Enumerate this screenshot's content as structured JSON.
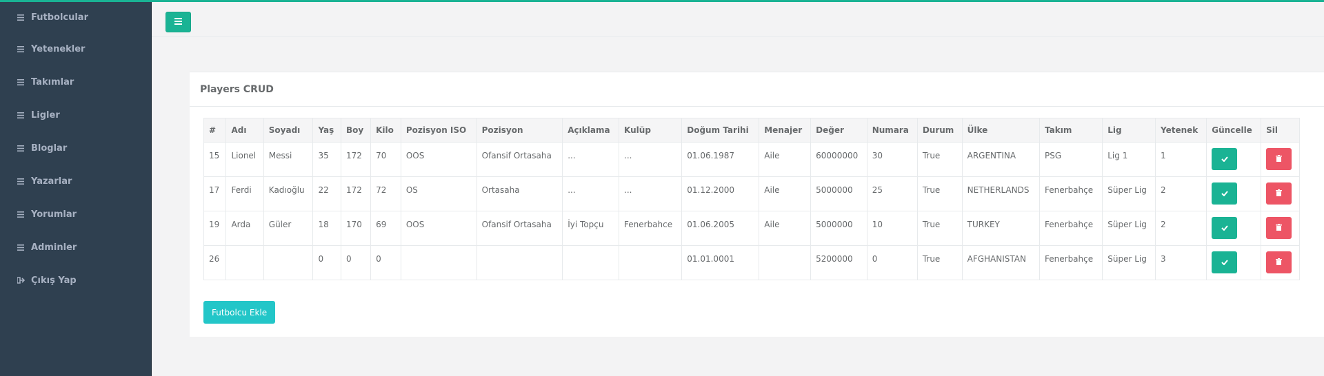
{
  "sidebar": {
    "items": [
      {
        "label": "Futbolcular",
        "icon": "menu-icon"
      },
      {
        "label": "Yetenekler",
        "icon": "menu-icon"
      },
      {
        "label": "Takımlar",
        "icon": "menu-icon"
      },
      {
        "label": "Ligler",
        "icon": "menu-icon"
      },
      {
        "label": "Bloglar",
        "icon": "menu-icon"
      },
      {
        "label": "Yazarlar",
        "icon": "menu-icon"
      },
      {
        "label": "Yorumlar",
        "icon": "menu-icon"
      },
      {
        "label": "Adminler",
        "icon": "menu-icon"
      },
      {
        "label": "Çıkış Yap",
        "icon": "sign-out-icon"
      }
    ]
  },
  "colors": {
    "accent": "#1ab394",
    "sidebar": "#2f4050",
    "danger": "#ed5565",
    "info": "#23c6c8"
  },
  "card": {
    "title": "Players CRUD"
  },
  "table": {
    "headers": [
      "#",
      "Adı",
      "Soyadı",
      "Yaş",
      "Boy",
      "Kilo",
      "Pozisyon ISO",
      "Pozisyon",
      "Açıklama",
      "Kulüp",
      "Doğum Tarihi",
      "Menajer",
      "Değer",
      "Numara",
      "Durum",
      "Ülke",
      "Takım",
      "Lig",
      "Yetenek",
      "Güncelle",
      "Sil"
    ],
    "rows": [
      [
        "15",
        "Lionel",
        "Messi",
        "35",
        "172",
        "70",
        "OOS",
        "Ofansif Ortasaha",
        "...",
        "...",
        "01.06.1987",
        "Aile",
        "60000000",
        "30",
        "True",
        "ARGENTINA",
        "PSG",
        "Lig 1",
        "1"
      ],
      [
        "17",
        "Ferdi",
        "Kadıoğlu",
        "22",
        "172",
        "72",
        "OS",
        "Ortasaha",
        "...",
        "...",
        "01.12.2000",
        "Aile",
        "5000000",
        "25",
        "True",
        "NETHERLANDS",
        "Fenerbahçe",
        "Süper Lig",
        "2"
      ],
      [
        "19",
        "Arda",
        "Güler",
        "18",
        "170",
        "69",
        "OOS",
        "Ofansif Ortasaha",
        "İyi Topçu",
        "Fenerbahce",
        "01.06.2005",
        "Aile",
        "5000000",
        "10",
        "True",
        "TURKEY",
        "Fenerbahçe",
        "Süper Lig",
        "2"
      ],
      [
        "26",
        "",
        "",
        "0",
        "0",
        "0",
        "",
        "",
        "",
        "",
        "01.01.0001",
        "",
        "5200000",
        "0",
        "True",
        "AFGHANISTAN",
        "Fenerbahçe",
        "Süper Lig",
        "3"
      ]
    ]
  },
  "add_button": "Futbolcu Ekle"
}
